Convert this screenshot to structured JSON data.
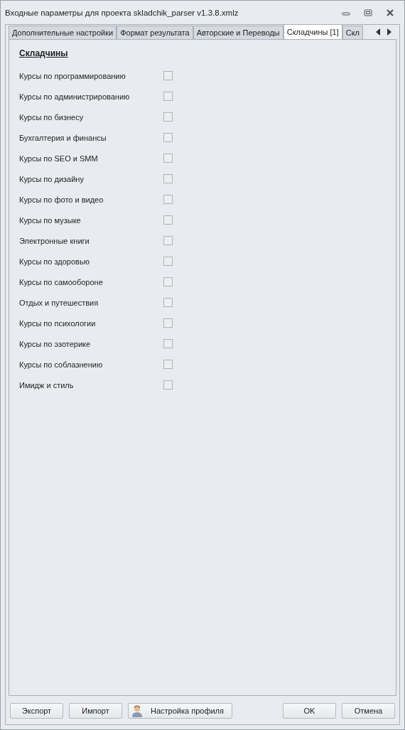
{
  "window": {
    "title": "Входные параметры для проекта skladchik_parser v1.3.8.xmlz"
  },
  "tabs": [
    {
      "label": "Дополнительные настройки",
      "selected": false
    },
    {
      "label": "Формат результата",
      "selected": false
    },
    {
      "label": "Авторские и Переводы",
      "selected": false
    },
    {
      "label": "Складчины [1]",
      "selected": true
    },
    {
      "label": "Скл",
      "selected": false
    }
  ],
  "section": {
    "title": "Складчины"
  },
  "options": [
    {
      "label": "Курсы по программированию",
      "checked": false
    },
    {
      "label": "Курсы по администрированию",
      "checked": false
    },
    {
      "label": "Курсы по бизнесу",
      "checked": false
    },
    {
      "label": "Бухгалтерия и финансы",
      "checked": false
    },
    {
      "label": "Курсы по SEO и SMM",
      "checked": false
    },
    {
      "label": "Курсы по дизайну",
      "checked": false
    },
    {
      "label": "Курсы по фото и видео",
      "checked": false
    },
    {
      "label": "Курсы по музыке",
      "checked": false
    },
    {
      "label": "Электронные книги",
      "checked": false
    },
    {
      "label": "Курсы по здоровью",
      "checked": false
    },
    {
      "label": "Курсы по самообороне",
      "checked": false
    },
    {
      "label": "Отдых и путешествия",
      "checked": false
    },
    {
      "label": "Курсы по психологии",
      "checked": false
    },
    {
      "label": "Курсы по эзотерике",
      "checked": false
    },
    {
      "label": "Курсы по соблазнению",
      "checked": false
    },
    {
      "label": "Имидж и стиль",
      "checked": false
    }
  ],
  "buttons_left": [
    {
      "label": "Экспорт",
      "kind": "plain"
    },
    {
      "label": "Импорт",
      "kind": "plain"
    },
    {
      "label": "Настройка профиля",
      "kind": "profile"
    }
  ],
  "buttons_right": [
    {
      "label": "OK"
    },
    {
      "label": "Отмена"
    }
  ]
}
